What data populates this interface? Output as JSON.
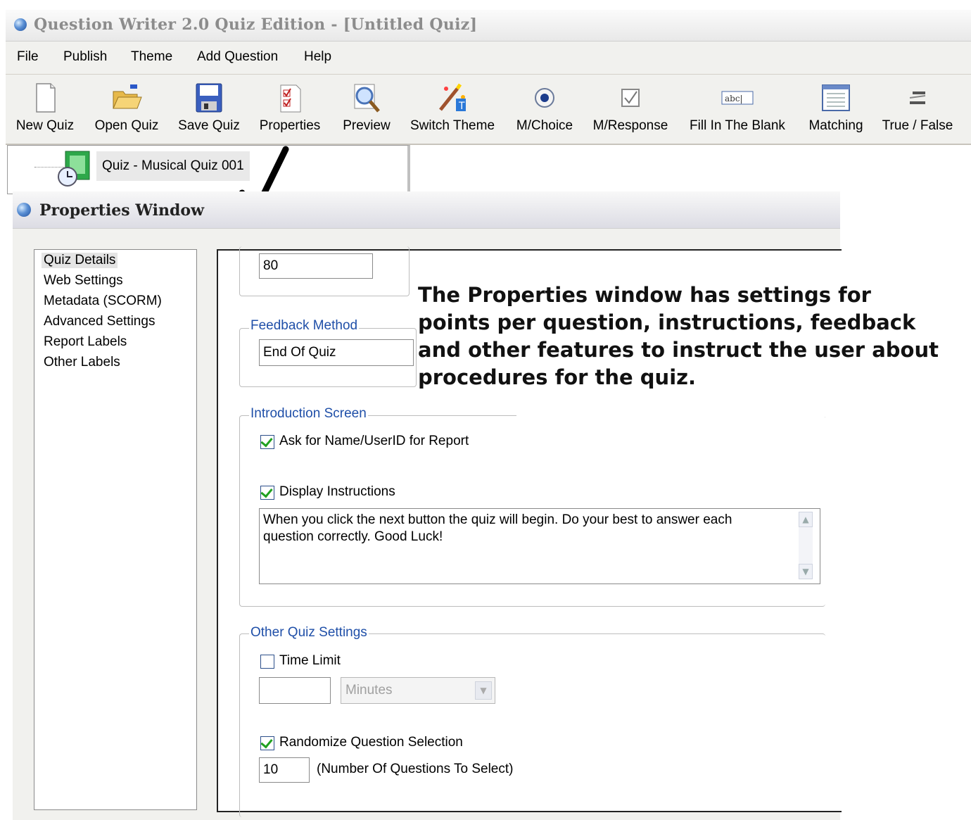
{
  "window": {
    "title": "Question Writer 2.0 Quiz Edition - [Untitled Quiz]"
  },
  "menu": [
    "File",
    "Publish",
    "Theme",
    "Add Question",
    "Help"
  ],
  "toolbar": [
    {
      "label": "New Quiz",
      "icon": "new-document-icon"
    },
    {
      "label": "Open Quiz",
      "icon": "open-folder-icon"
    },
    {
      "label": "Save Quiz",
      "icon": "floppy-disk-icon"
    },
    {
      "label": "Properties",
      "icon": "checklist-icon"
    },
    {
      "label": "Preview",
      "icon": "magnifier-icon"
    },
    {
      "label": "Switch Theme",
      "icon": "magic-wand-icon"
    },
    {
      "label": "M/Choice",
      "icon": "radio-button-icon"
    },
    {
      "label": "M/Response",
      "icon": "checkbox-icon"
    },
    {
      "label": "Fill In The Blank",
      "icon": "text-field-icon"
    },
    {
      "label": "Matching",
      "icon": "table-icon"
    },
    {
      "label": "True / False",
      "icon": "true-false-icon"
    }
  ],
  "tree": {
    "node_label": "Quiz - Musical Quiz 001"
  },
  "properties": {
    "title": "Properties Window",
    "nav": [
      "Quiz Details",
      "Web Settings",
      "Metadata (SCORM)",
      "Advanced Settings",
      "Report Labels",
      "Other Labels"
    ],
    "nav_selected": 0,
    "points_value": "80",
    "feedback": {
      "legend": "Feedback Method",
      "value": "End Of Quiz"
    },
    "intro": {
      "legend": "Introduction Screen",
      "ask_name": {
        "label": "Ask for Name/UserID for Report",
        "checked": true
      },
      "display_instructions": {
        "label": "Display Instructions",
        "checked": true
      },
      "instructions_text": "When you click the next button the quiz will begin. Do your best to answer each question correctly. Good Luck!"
    },
    "other": {
      "legend": "Other Quiz Settings",
      "time_limit": {
        "label": "Time Limit",
        "checked": false,
        "value": "",
        "unit": "Minutes"
      },
      "randomize": {
        "label": "Randomize Question Selection",
        "checked": true
      },
      "num_questions": {
        "value": "10",
        "label": "(Number Of Questions To Select)"
      }
    }
  },
  "callout": "The Properties window has settings for points per question, instructions, feedback and other features to instruct the user about procedures for the quiz."
}
